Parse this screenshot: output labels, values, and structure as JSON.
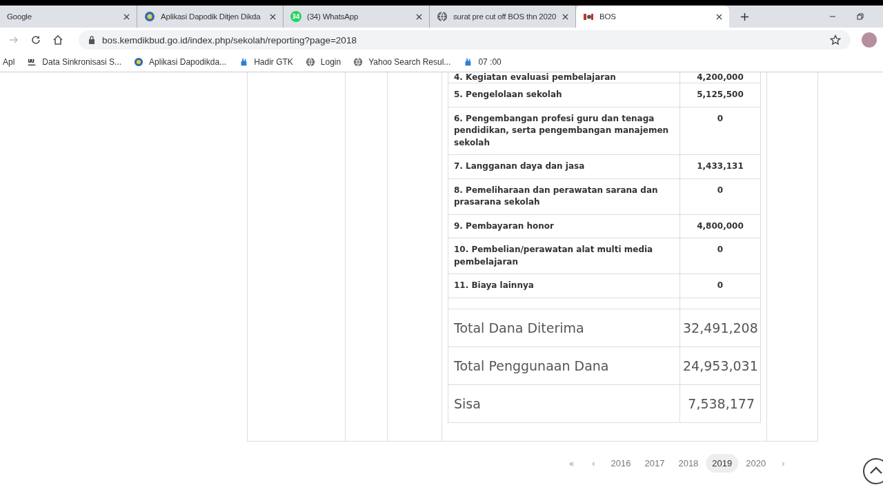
{
  "tabs": [
    {
      "title": "Google",
      "selected": false
    },
    {
      "title": "Aplikasi Dapodik Ditjen Dikda",
      "selected": false
    },
    {
      "title": "(34) WhatsApp",
      "badge": "34",
      "selected": false
    },
    {
      "title": "surat pre cut off BOS thn 2020",
      "selected": false
    },
    {
      "title": "BOS",
      "selected": true
    }
  ],
  "address": {
    "url": "bos.kemdikbud.go.id/index.php/sekolah/reporting?page=2018"
  },
  "bookmarks": [
    {
      "label": "Apl"
    },
    {
      "label": "Data Sinkronisasi S..."
    },
    {
      "label": "Aplikasi Dapodikda..."
    },
    {
      "label": "Hadir GTK"
    },
    {
      "label": "Login"
    },
    {
      "label": "Yahoo Search Resul..."
    },
    {
      "label": "07 :00"
    }
  ],
  "table": {
    "rows": [
      {
        "label": "4. Kegiatan evaluasi pembelajaran",
        "amount": "4,200,000",
        "kind": "item"
      },
      {
        "label": "5. Pengelolaan sekolah",
        "amount": "5,125,500",
        "kind": "item"
      },
      {
        "label": "6. Pengembangan profesi guru dan tenaga pendidikan, serta pengembangan manajemen sekolah",
        "amount": "0",
        "kind": "item"
      },
      {
        "label": "7. Langganan daya dan jasa",
        "amount": "1,433,131",
        "kind": "item"
      },
      {
        "label": "8. Pemeliharaan dan perawatan sarana dan prasarana sekolah",
        "amount": "0",
        "kind": "item"
      },
      {
        "label": "9. Pembayaran honor",
        "amount": "4,800,000",
        "kind": "item"
      },
      {
        "label": "10. Pembelian/perawatan alat multi media pembelajaran",
        "amount": "0",
        "kind": "item"
      },
      {
        "label": "11. Biaya lainnya",
        "amount": "0",
        "kind": "item"
      },
      {
        "kind": "spacer"
      },
      {
        "label": "Total Dana Diterima",
        "amount": "32,491,208",
        "kind": "total"
      },
      {
        "label": "Total Penggunaan Dana",
        "amount": "24,953,031",
        "kind": "total"
      },
      {
        "label": "Sisa",
        "amount": "7,538,177",
        "kind": "total"
      }
    ]
  },
  "pagination": {
    "first": "«",
    "prev": "‹",
    "next": "›",
    "pages": [
      {
        "label": "2016",
        "selected": false
      },
      {
        "label": "2017",
        "selected": false
      },
      {
        "label": "2018",
        "selected": false
      },
      {
        "label": "2019",
        "selected": true
      },
      {
        "label": "2020",
        "selected": false
      }
    ]
  }
}
